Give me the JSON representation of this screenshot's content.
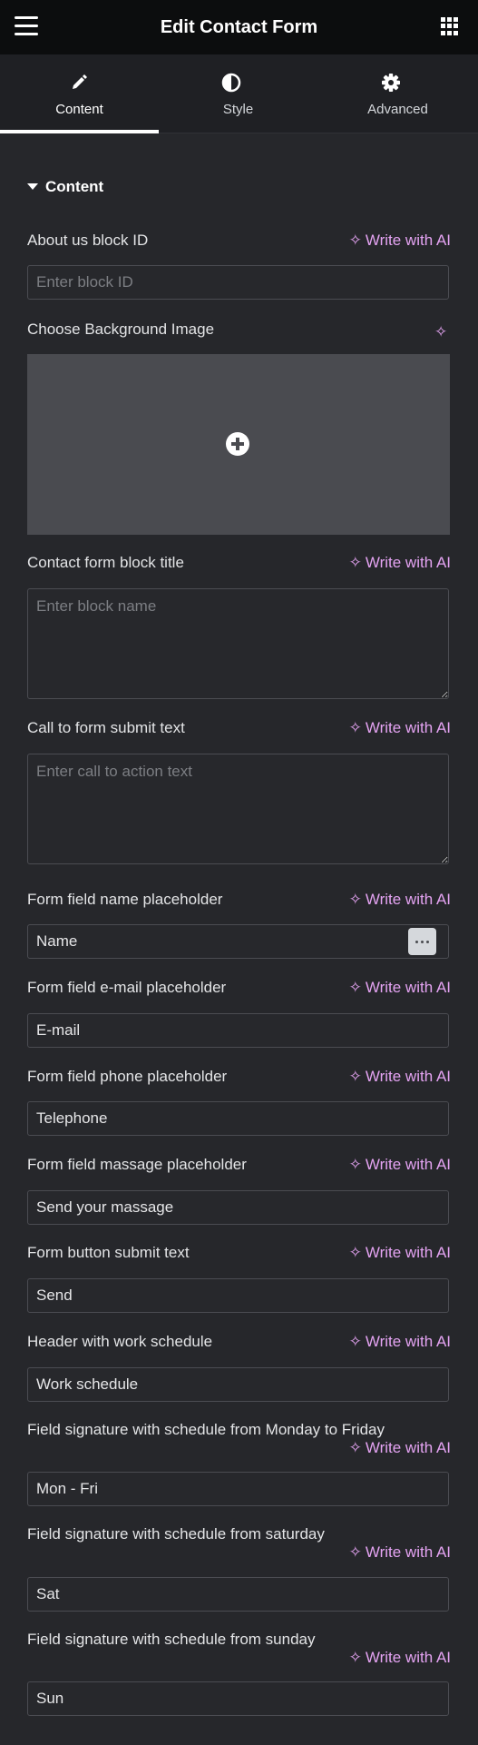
{
  "header": {
    "title": "Edit Contact Form",
    "menu_icon": "hamburger-menu-icon",
    "apps_icon": "apps-grid-icon"
  },
  "tabs": [
    {
      "label": "Content",
      "icon": "pencil-icon",
      "active": true
    },
    {
      "label": "Style",
      "icon": "half-circle-icon",
      "active": false
    },
    {
      "label": "Advanced",
      "icon": "gear-icon",
      "active": false
    }
  ],
  "section": {
    "title": "Content"
  },
  "ai_label": "Write with AI",
  "accent_color": "#e4a3f2",
  "fields": {
    "block_id": {
      "label": "About us block ID",
      "placeholder": "Enter block ID"
    },
    "bg_image": {
      "label": "Choose Background Image"
    },
    "block_title": {
      "label": "Contact form block title",
      "placeholder": "Enter block name"
    },
    "cta": {
      "label": "Call to form submit text",
      "placeholder": "Enter call to action text"
    },
    "name_ph": {
      "label": "Form field name placeholder",
      "value": "Name"
    },
    "email_ph": {
      "label": "Form field e-mail placeholder",
      "value": "E-mail"
    },
    "phone_ph": {
      "label": "Form field phone placeholder",
      "value": "Telephone"
    },
    "massage_ph": {
      "label": "Form field massage placeholder",
      "value": "Send your massage"
    },
    "submit_text": {
      "label": "Form button submit text",
      "value": "Send"
    },
    "schedule_header": {
      "label": "Header with work schedule",
      "value": "Work schedule"
    },
    "mon_fri": {
      "label": "Field signature with schedule from Monday to Friday",
      "value": "Mon - Fri"
    },
    "saturday": {
      "label": "Field signature with schedule from saturday",
      "value": "Sat"
    },
    "sunday": {
      "label": "Field signature with schedule from sunday",
      "value": "Sun"
    }
  }
}
